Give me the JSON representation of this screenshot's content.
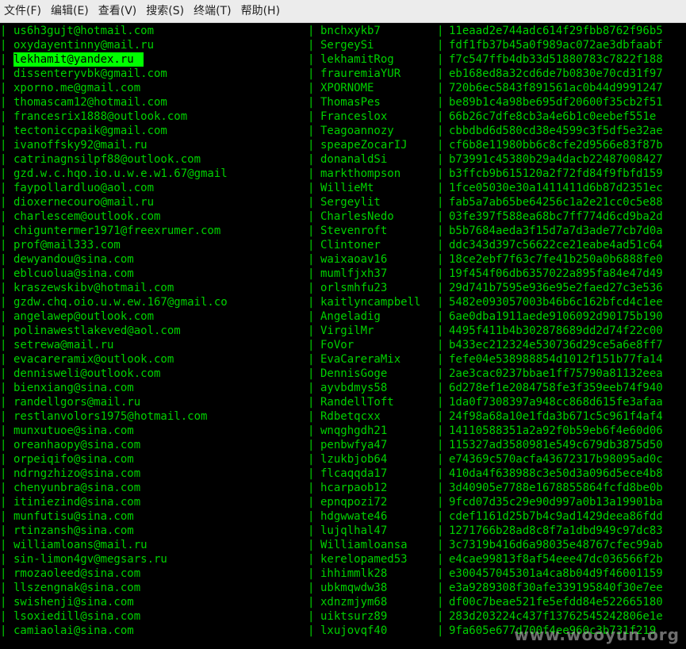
{
  "menubar": {
    "items": [
      "文件(F)",
      "编辑(E)",
      "查看(V)",
      "搜索(S)",
      "终端(T)",
      "帮助(H)"
    ]
  },
  "terminal": {
    "separator": "|",
    "highlight_row": 2,
    "rows": [
      {
        "email": "us6h3gujt@hotmail.com",
        "user": "bnchxykb7",
        "hash": "11eaad2e744adc614f29fbb8762f96b5"
      },
      {
        "email": "oxydayentinny@mail.ru",
        "user": "SergeySi",
        "hash": "fdf1fb37b45a0f989ac072ae3dbfaabf"
      },
      {
        "email": "lekhamit@yandex.ru",
        "user": "lekhamitRog",
        "hash": "f7c547ffb4db33d51880783c7822f188"
      },
      {
        "email": "dissenteryvbk@gmail.com",
        "user": "frauremiaYUR",
        "hash": "eb168ed8a32cd6de7b0830e70cd31f97"
      },
      {
        "email": "xporno.me@gmail.com",
        "user": "XPORNOME",
        "hash": "720b6ec5843f891561ac0b44d9991247"
      },
      {
        "email": "thomascam12@hotmail.com",
        "user": "ThomasPes",
        "hash": "be89b1c4a98be695df20600f35cb2f51"
      },
      {
        "email": "francesrix1888@outlook.com",
        "user": "Franceslox",
        "hash": "66b26c7dfe8cb3a4e6b1c0eebef551e"
      },
      {
        "email": "tectoniccpaik@gmail.com",
        "user": "Teagoannozy",
        "hash": "cbbdbd6d580cd38e4599c3f5df5e32ae"
      },
      {
        "email": "ivanoffsky92@mail.ru",
        "user": "speapeZocarIJ",
        "hash": "cf6b8e11980bb6c8cfe2d9566e83f87b"
      },
      {
        "email": "catrinagnsilpf88@outlook.com",
        "user": "donanaldSi",
        "hash": "b73991c45380b29a4dacb22487008427"
      },
      {
        "email": "gzd.w.c.hqo.io.u.w.e.w1.67@gmail",
        "user": "markthompson",
        "hash": "b3ffcb9b615120a2f72fd84f9fbfd159"
      },
      {
        "email": "faypollardluo@aol.com",
        "user": "WillieMt",
        "hash": "1fce05030e30a1411411d6b87d2351ec"
      },
      {
        "email": "dioxernecouro@mail.ru",
        "user": "Sergeylit",
        "hash": "fab5a7ab65be64256c1a2e21cc0c5e88"
      },
      {
        "email": "charlescem@outlook.com",
        "user": "CharlesNedo",
        "hash": "03fe397f588ea68bc7ff774d6cd9ba2d"
      },
      {
        "email": "chiguntermer1971@freexrumer.com",
        "user": "Stevenroft",
        "hash": "b5b7684aeda3f15d7a7d3ade77cb7d0a"
      },
      {
        "email": "prof@mail333.com",
        "user": "Clintoner",
        "hash": "ddc343d397c56622ce21eabe4ad51c64"
      },
      {
        "email": "dewyandou@sina.com",
        "user": "waixaoav16",
        "hash": "18ce2ebf7f63c7fe41b250a0b6888fe0"
      },
      {
        "email": "eblcuolua@sina.com",
        "user": "mumlfjxh37",
        "hash": "19f454f06db6357022a895fa84e47d49"
      },
      {
        "email": "kraszewskibv@hotmail.com",
        "user": "orlsmhfu23",
        "hash": "29d741b7595e936e95e2faed27c3e536"
      },
      {
        "email": "gzdw.chq.oio.u.w.ew.167@gmail.co",
        "user": "kaitlyncampbell",
        "hash": "5482e093057003b46b6c162bfcd4c1ee"
      },
      {
        "email": "angelawep@outlook.com",
        "user": "Angeladig",
        "hash": "6ae0dba1911aede9106092d90175b190"
      },
      {
        "email": "polinawestlakeved@aol.com",
        "user": "VirgilMr",
        "hash": "4495f411b4b302878689dd2d74f22c00"
      },
      {
        "email": "setrewa@mail.ru",
        "user": "FoVor",
        "hash": "b433ec212324e530736d29ce5a6e8ff7"
      },
      {
        "email": "evacareramix@outlook.com",
        "user": "EvaCareraMix",
        "hash": "fefe04e538988854d1012f151b77fa14"
      },
      {
        "email": "dennisweli@outlook.com",
        "user": "DennisGoge",
        "hash": "2ae3cac0237bbae1ff75790a81132eea"
      },
      {
        "email": "bienxiang@sina.com",
        "user": "ayvbdmys58",
        "hash": "6d278ef1e2084758fe3f359eeb74f940"
      },
      {
        "email": "randellgors@mail.ru",
        "user": "RandellToft",
        "hash": "1da0f7308397a948cc868d615fe3afaa"
      },
      {
        "email": "restlanvolors1975@hotmail.com",
        "user": "Rdbetqcxx",
        "hash": "24f98a68a10e1fda3b671c5c961f4af4"
      },
      {
        "email": "munxutuoe@sina.com",
        "user": "wnqghgdh21",
        "hash": "14110588351a2a92f0b59eb6f4e60d06"
      },
      {
        "email": "oreanhaopy@sina.com",
        "user": "penbwfya47",
        "hash": "115327ad3580981e549c679db3875d50"
      },
      {
        "email": "orpeiqifo@sina.com",
        "user": "lzukbjob64",
        "hash": "e74369c570acfa43672317b98095ad0c"
      },
      {
        "email": "ndrngzhizo@sina.com",
        "user": "flcaqqda17",
        "hash": "410da4f638988c3e50d3a096d5ece4b8"
      },
      {
        "email": "chenyunbra@sina.com",
        "user": "hcarpaob12",
        "hash": "3d40905e7788e1678855864fcfd8be0b"
      },
      {
        "email": "itiniezind@sina.com",
        "user": "epnqpozi72",
        "hash": "9fcd07d35c29e90d997a0b13a19901ba"
      },
      {
        "email": "munfutisu@sina.com",
        "user": "hdgwwate46",
        "hash": "cdef1161d25b7b4c9ad1429deea86fdd"
      },
      {
        "email": "rtinzansh@sina.com",
        "user": "lujqlhal47",
        "hash": "1271766b28ad8c8f7a1dbd949c97dc83"
      },
      {
        "email": "williamloans@mail.ru",
        "user": "Williamloansa",
        "hash": "3c7319b416d6a98035e48767cfec99ab"
      },
      {
        "email": "sin-limon4gv@megsars.ru",
        "user": "kerelopamed53",
        "hash": "e4cae99813f8af54eee47dc036566f2b"
      },
      {
        "email": "rmozaoleed@sina.com",
        "user": "ihhimmlk28",
        "hash": "e300457045301a4ca8b04d9f46001159"
      },
      {
        "email": "llszengnak@sina.com",
        "user": "ubkmqwdw38",
        "hash": "e3a9289308f30afe339195840f30e7ee"
      },
      {
        "email": "swishenji@sina.com",
        "user": "xdnzmjym68",
        "hash": "df00c7beae521fe5efdd84e522665180"
      },
      {
        "email": "lsoxiedill@sina.com",
        "user": "uiktsurz89",
        "hash": "283d203224c437f13762545242806e1e"
      },
      {
        "email": "camiaolai@sina.com",
        "user": "lxujovqf40",
        "hash": "9fa605e677d700f4ee960c3b731f219"
      }
    ]
  },
  "watermark": "www.wooyun.org"
}
